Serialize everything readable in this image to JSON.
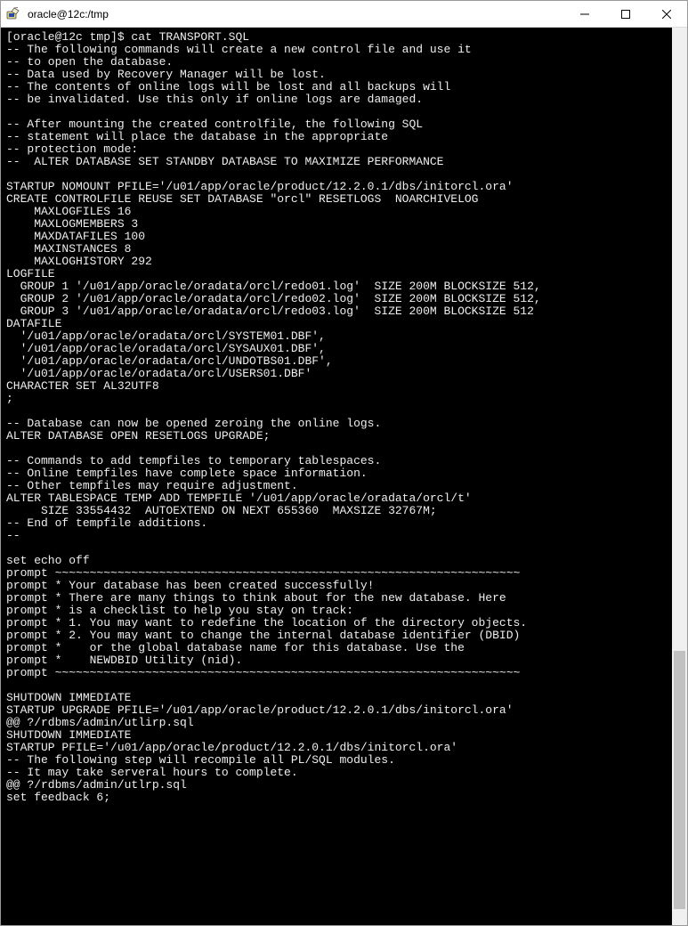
{
  "window": {
    "title": "oracle@12c:/tmp"
  },
  "terminal": {
    "lines": [
      "[oracle@12c tmp]$ cat TRANSPORT.SQL",
      "-- The following commands will create a new control file and use it",
      "-- to open the database.",
      "-- Data used by Recovery Manager will be lost.",
      "-- The contents of online logs will be lost and all backups will",
      "-- be invalidated. Use this only if online logs are damaged.",
      "",
      "-- After mounting the created controlfile, the following SQL",
      "-- statement will place the database in the appropriate",
      "-- protection mode:",
      "--  ALTER DATABASE SET STANDBY DATABASE TO MAXIMIZE PERFORMANCE",
      "",
      "STARTUP NOMOUNT PFILE='/u01/app/oracle/product/12.2.0.1/dbs/initorcl.ora'",
      "CREATE CONTROLFILE REUSE SET DATABASE \"orcl\" RESETLOGS  NOARCHIVELOG",
      "    MAXLOGFILES 16",
      "    MAXLOGMEMBERS 3",
      "    MAXDATAFILES 100",
      "    MAXINSTANCES 8",
      "    MAXLOGHISTORY 292",
      "LOGFILE",
      "  GROUP 1 '/u01/app/oracle/oradata/orcl/redo01.log'  SIZE 200M BLOCKSIZE 512,",
      "  GROUP 2 '/u01/app/oracle/oradata/orcl/redo02.log'  SIZE 200M BLOCKSIZE 512,",
      "  GROUP 3 '/u01/app/oracle/oradata/orcl/redo03.log'  SIZE 200M BLOCKSIZE 512",
      "DATAFILE",
      "  '/u01/app/oracle/oradata/orcl/SYSTEM01.DBF',",
      "  '/u01/app/oracle/oradata/orcl/SYSAUX01.DBF',",
      "  '/u01/app/oracle/oradata/orcl/UNDOTBS01.DBF',",
      "  '/u01/app/oracle/oradata/orcl/USERS01.DBF'",
      "CHARACTER SET AL32UTF8",
      ";",
      "",
      "-- Database can now be opened zeroing the online logs.",
      "ALTER DATABASE OPEN RESETLOGS UPGRADE;",
      "",
      "-- Commands to add tempfiles to temporary tablespaces.",
      "-- Online tempfiles have complete space information.",
      "-- Other tempfiles may require adjustment.",
      "ALTER TABLESPACE TEMP ADD TEMPFILE '/u01/app/oracle/oradata/orcl/t'",
      "     SIZE 33554432  AUTOEXTEND ON NEXT 655360  MAXSIZE 32767M;",
      "-- End of tempfile additions.",
      "--",
      "",
      "set echo off",
      "prompt ~~~~~~~~~~~~~~~~~~~~~~~~~~~~~~~~~~~~~~~~~~~~~~~~~~~~~~~~~~~~~~~~~~~",
      "prompt * Your database has been created successfully!",
      "prompt * There are many things to think about for the new database. Here",
      "prompt * is a checklist to help you stay on track:",
      "prompt * 1. You may want to redefine the location of the directory objects.",
      "prompt * 2. You may want to change the internal database identifier (DBID)",
      "prompt *    or the global database name for this database. Use the",
      "prompt *    NEWDBID Utility (nid).",
      "prompt ~~~~~~~~~~~~~~~~~~~~~~~~~~~~~~~~~~~~~~~~~~~~~~~~~~~~~~~~~~~~~~~~~~~",
      "",
      "SHUTDOWN IMMEDIATE",
      "STARTUP UPGRADE PFILE='/u01/app/oracle/product/12.2.0.1/dbs/initorcl.ora'",
      "@@ ?/rdbms/admin/utlirp.sql",
      "SHUTDOWN IMMEDIATE",
      "STARTUP PFILE='/u01/app/oracle/product/12.2.0.1/dbs/initorcl.ora'",
      "-- The following step will recompile all PL/SQL modules.",
      "-- It may take serveral hours to complete.",
      "@@ ?/rdbms/admin/utlrp.sql",
      "set feedback 6;"
    ]
  }
}
